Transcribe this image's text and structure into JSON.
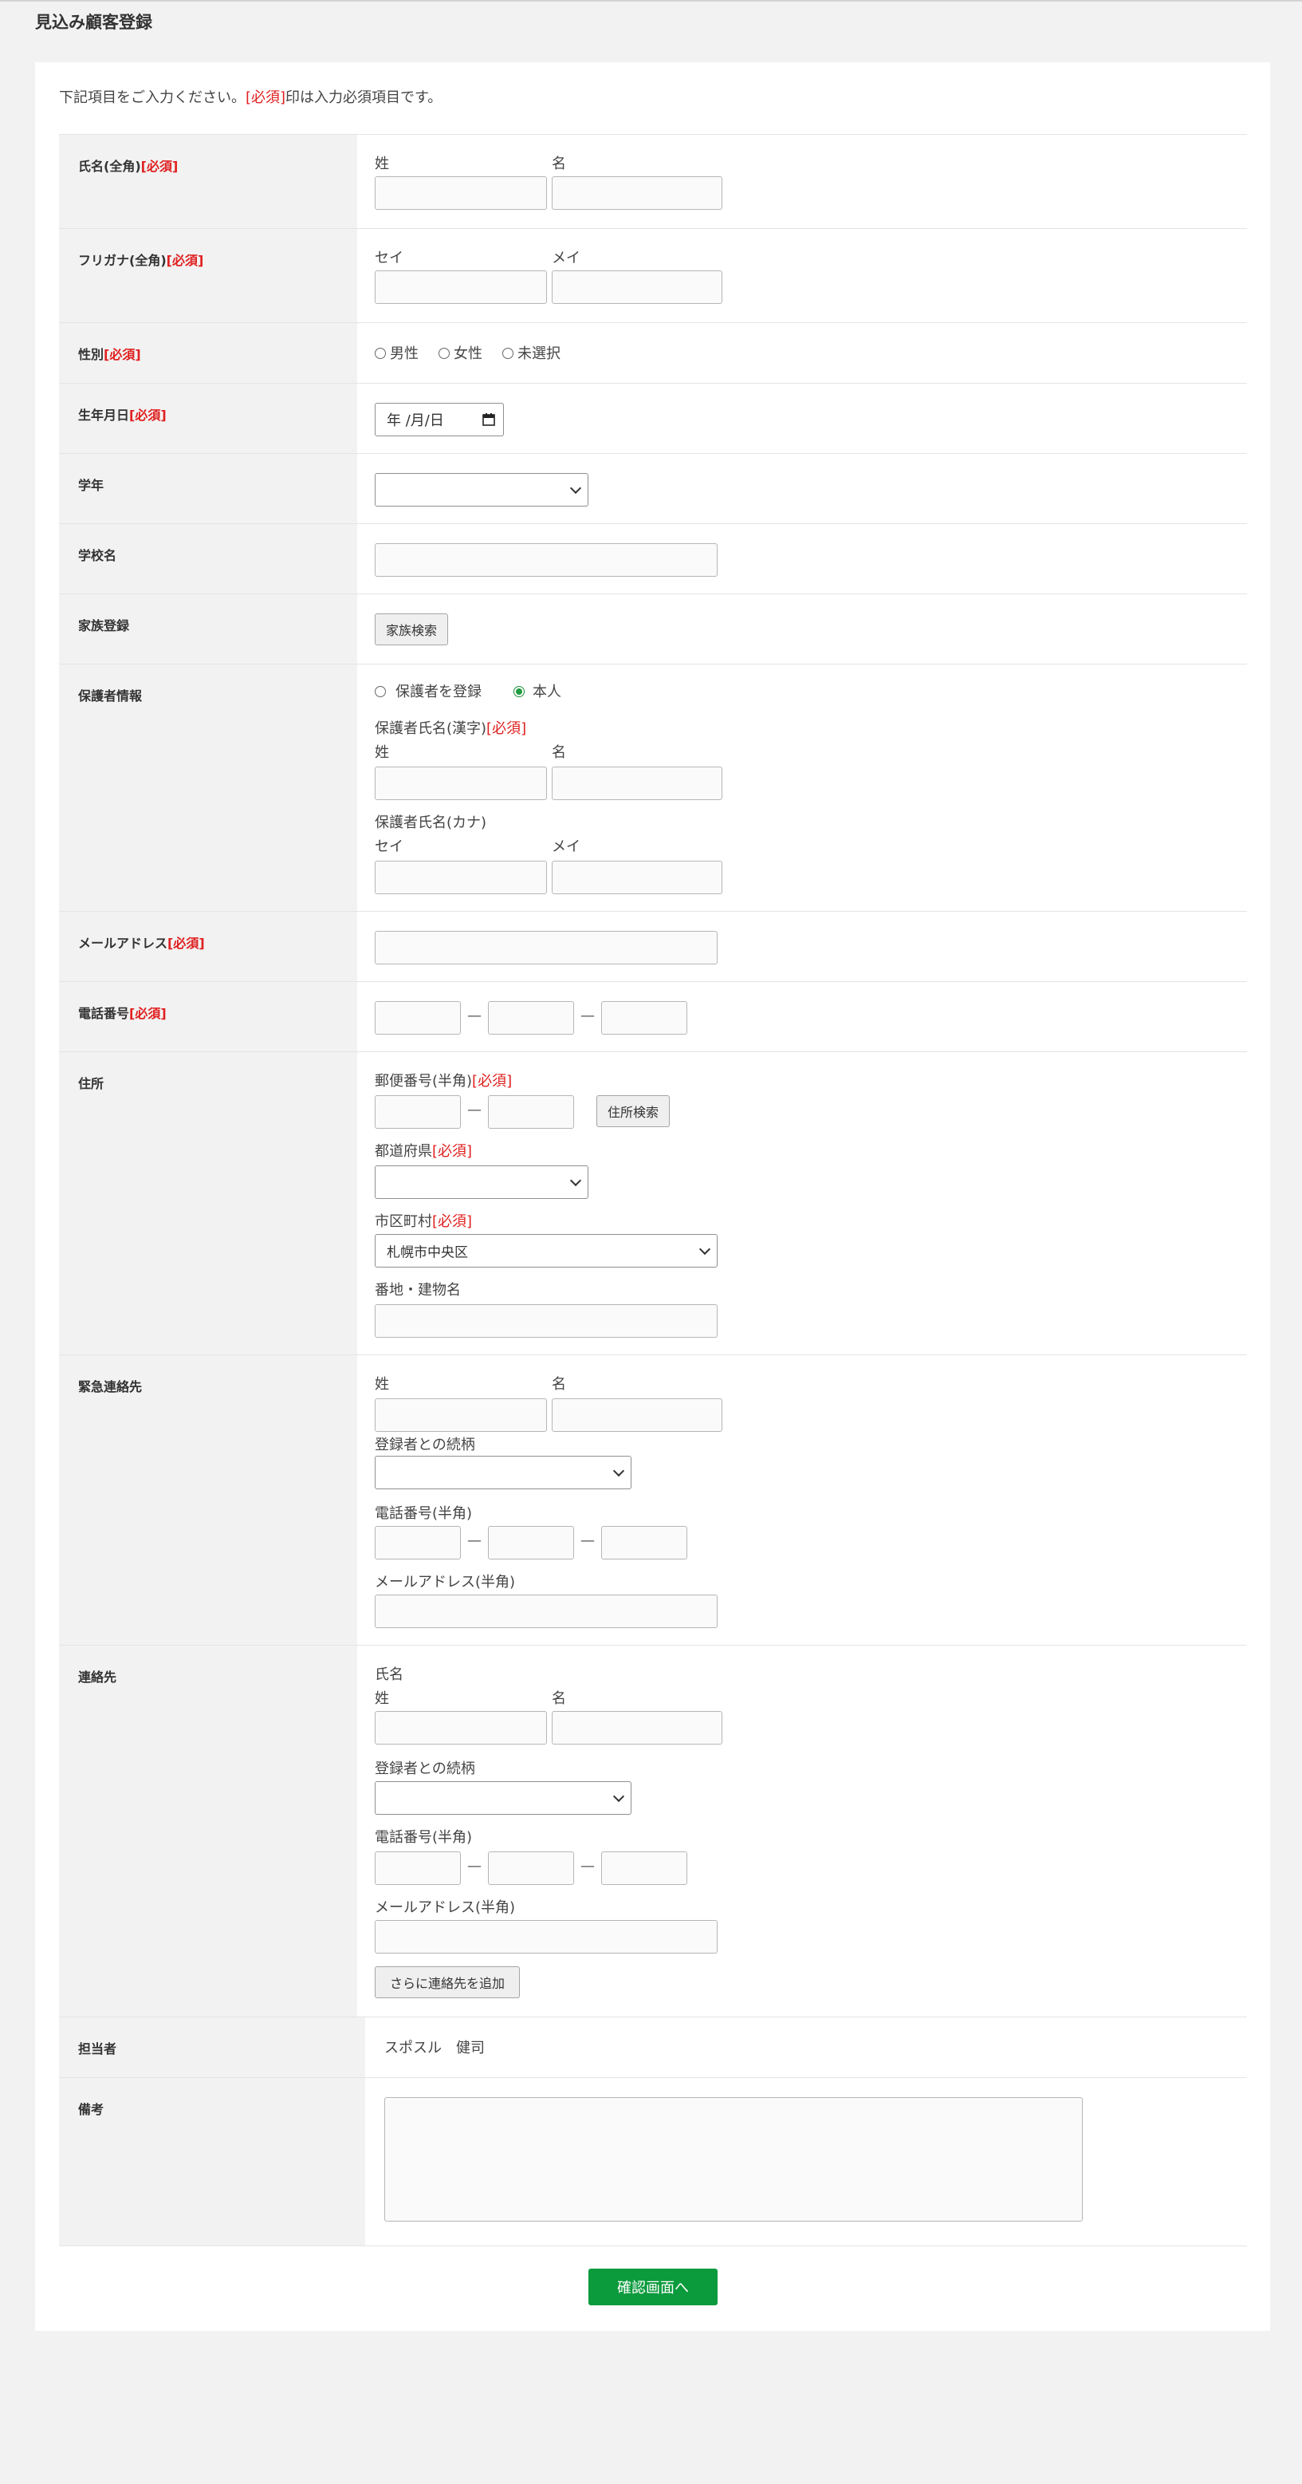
{
  "title": "見込み顧客登録",
  "intro": {
    "before": "下記項目をご入力ください。",
    "req": "[必須]",
    "after": "印は入力必須項目です。"
  },
  "required_tag": "[必須]",
  "rows": {
    "name": "氏名(全角)",
    "kana": "フリガナ(全角)",
    "gender": "性別",
    "birth": "生年月日",
    "grade": "学年",
    "school": "学校名",
    "family": "家族登録",
    "guardian": "保護者情報",
    "email": "メールアドレス",
    "phone": "電話番号",
    "address": "住所",
    "emergency": "緊急連絡先",
    "contact": "連絡先",
    "staff": "担当者",
    "note": "備考"
  },
  "name_fields": {
    "sei": "姓",
    "mei": "名"
  },
  "kana_fields": {
    "sei": "セイ",
    "mei": "メイ"
  },
  "gender_options": [
    "男性",
    "女性",
    "未選択"
  ],
  "birth_placeholder": "年 /月/日",
  "family_button": "家族検索",
  "guardian": {
    "options": [
      "保護者を登録",
      "本人"
    ],
    "selected": "本人",
    "kanji_label": "保護者氏名(漢字)",
    "kana_label": "保護者氏名(カナ)"
  },
  "address": {
    "postal_label": "郵便番号(半角)",
    "postal_button": "住所検索",
    "pref_label": "都道府県",
    "city_label": "市区町村",
    "city_value": "札幌市中央区",
    "street_label": "番地・建物名"
  },
  "emergency": {
    "relation_label": "登録者との続柄",
    "phone_label": "電話番号(半角)",
    "email_label": "メールアドレス(半角)"
  },
  "contact": {
    "name_label": "氏名",
    "relation_label": "登録者との続柄",
    "phone_label": "電話番号(半角)",
    "email_label": "メールアドレス(半角)",
    "add_button": "さらに連絡先を追加"
  },
  "staff_value": "スポスル　健司",
  "dash": "—",
  "submit_label": "確認画面へ",
  "colors": {
    "accent": "#0b9a3c",
    "required": "#e02020"
  }
}
